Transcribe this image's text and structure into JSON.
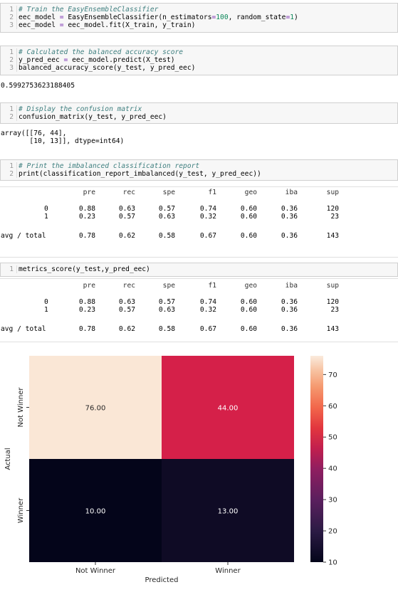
{
  "cells": [
    {
      "lines": [
        {
          "n": "1",
          "parts": [
            [
              "cm",
              "# Train the EasyEnsembleClassifier"
            ]
          ]
        },
        {
          "n": "2",
          "parts": [
            [
              "",
              "eec_model "
            ],
            [
              "op",
              "="
            ],
            [
              "",
              " EasyEnsembleClassifier(n_estimators"
            ],
            [
              "op",
              "="
            ],
            [
              "nm",
              "100"
            ],
            [
              "",
              ", random_state"
            ],
            [
              "op",
              "="
            ],
            [
              "nm",
              "1"
            ],
            [
              "",
              ")"
            ]
          ]
        },
        {
          "n": "3",
          "parts": [
            [
              "",
              "eec_model "
            ],
            [
              "op",
              "="
            ],
            [
              "",
              " eec_model.fit(X_train, y_train)"
            ]
          ]
        }
      ]
    },
    {
      "lines": [
        {
          "n": "1",
          "parts": [
            [
              "cm",
              "# Calculated the balanced accuracy score"
            ]
          ]
        },
        {
          "n": "2",
          "parts": [
            [
              "",
              "y_pred_eec "
            ],
            [
              "op",
              "="
            ],
            [
              "",
              " eec_model.predict(X_test)"
            ]
          ]
        },
        {
          "n": "3",
          "parts": [
            [
              "",
              "balanced_accuracy_score(y_test, y_pred_eec)"
            ]
          ]
        }
      ]
    },
    {
      "lines": [
        {
          "n": "1",
          "parts": [
            [
              "cm",
              "# Display the confusion matrix"
            ]
          ]
        },
        {
          "n": "2",
          "parts": [
            [
              "",
              "confusion_matrix(y_test, y_pred_eec)"
            ]
          ]
        }
      ]
    },
    {
      "lines": [
        {
          "n": "1",
          "parts": [
            [
              "cm",
              "# Print the imbalanced classification report"
            ]
          ]
        },
        {
          "n": "2",
          "parts": [
            [
              "",
              "print(classification_report_imbalanced(y_test, y_pred_eec))"
            ]
          ]
        }
      ]
    },
    {
      "lines": [
        {
          "n": "1",
          "parts": [
            [
              "",
              "metrics_score(y_test,y_pred_eec)"
            ]
          ]
        }
      ]
    }
  ],
  "outputs": {
    "accuracy": "0.5992753623188405",
    "confusion_line1": "array([[76, 44],",
    "confusion_line2": "       [10, 13]], dtype=int64)"
  },
  "report": {
    "headers": [
      "pre",
      "rec",
      "spe",
      "f1",
      "geo",
      "iba",
      "sup"
    ],
    "rows": [
      {
        "label": "0",
        "values": [
          "0.88",
          "0.63",
          "0.57",
          "0.74",
          "0.60",
          "0.36",
          "120"
        ]
      },
      {
        "label": "1",
        "values": [
          "0.23",
          "0.57",
          "0.63",
          "0.32",
          "0.60",
          "0.36",
          "23"
        ]
      }
    ],
    "total": {
      "label": "avg / total",
      "values": [
        "0.78",
        "0.62",
        "0.58",
        "0.67",
        "0.60",
        "0.36",
        "143"
      ]
    }
  },
  "heatmap": {
    "xlabel": "Predicted",
    "ylabel": "Actual",
    "x_ticks": [
      "Not Winner",
      "Winner"
    ],
    "y_ticks": [
      "Not Winner",
      "Winner"
    ],
    "cells": [
      [
        {
          "text": "76.00",
          "value": 76,
          "color": "#fae7d6",
          "text_color": "#262626"
        },
        {
          "text": "44.00",
          "value": 44,
          "color": "#d52049",
          "text_color": "#ffffff"
        }
      ],
      [
        {
          "text": "10.00",
          "value": 10,
          "color": "#04051a",
          "text_color": "#ffffff"
        },
        {
          "text": "13.00",
          "value": 13,
          "color": "#0f0b25",
          "text_color": "#ffffff"
        }
      ]
    ],
    "colorbar_ticks": [
      "70",
      "60",
      "50",
      "40",
      "30",
      "20",
      "10"
    ],
    "colorbar_min": 10,
    "colorbar_max": 76
  },
  "chart_data": {
    "type": "heatmap",
    "x": [
      "Not Winner",
      "Winner"
    ],
    "y": [
      "Not Winner",
      "Winner"
    ],
    "values": [
      [
        76,
        44
      ],
      [
        10,
        13
      ]
    ],
    "xlabel": "Predicted",
    "ylabel": "Actual",
    "colorbar_range": [
      10,
      76
    ],
    "colorbar_ticks": [
      10,
      20,
      30,
      40,
      50,
      60,
      70
    ]
  }
}
